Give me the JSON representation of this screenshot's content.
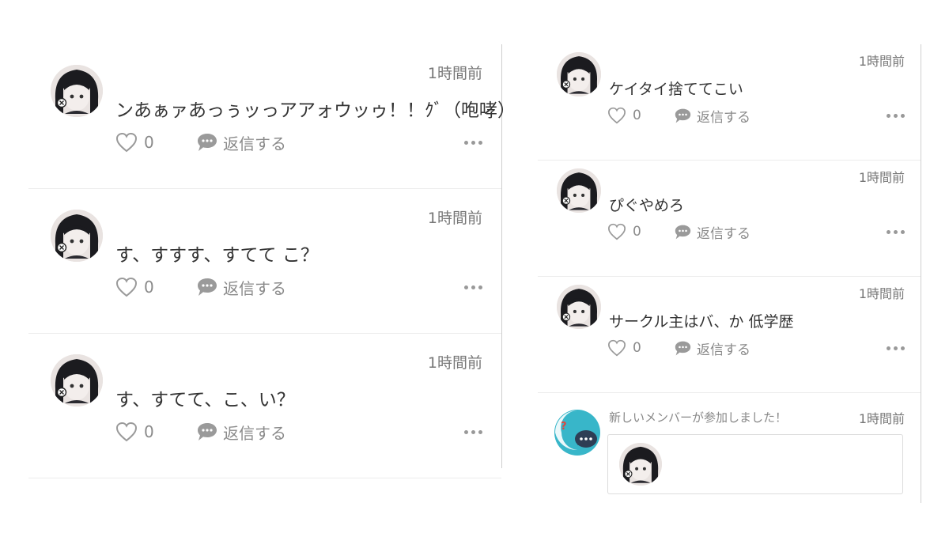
{
  "left_posts": [
    {
      "time": "1時間前",
      "text": "ンあぁァあっぅッっアアォウッゥ！！ｸﾞ（咆哮）",
      "likes": "0",
      "reply_label": "返信する"
    },
    {
      "time": "1時間前",
      "text": "す、すすす、すてて こ？",
      "likes": "0",
      "reply_label": "返信する"
    },
    {
      "time": "1時間前",
      "text": "す、すてて、こ、い？",
      "likes": "0",
      "reply_label": "返信する"
    }
  ],
  "right_posts": [
    {
      "time": "1時間前",
      "text": "ケイタイ捨ててこい",
      "likes": "0",
      "reply_label": "返信する"
    },
    {
      "time": "1時間前",
      "text": "ぴぐやめろ",
      "likes": "0",
      "reply_label": "返信する"
    },
    {
      "time": "1時間前",
      "text": "サークル主はバ、か 低学歴",
      "likes": "0",
      "reply_label": "返信する"
    }
  ],
  "notice": {
    "text": "新しいメンバーが参加しました！",
    "time": "1時間前"
  },
  "colors": {
    "notice_icon_bg": "#38b6c9",
    "notice_bubble": "#2e3e55",
    "question_mark": "#e0463c"
  }
}
